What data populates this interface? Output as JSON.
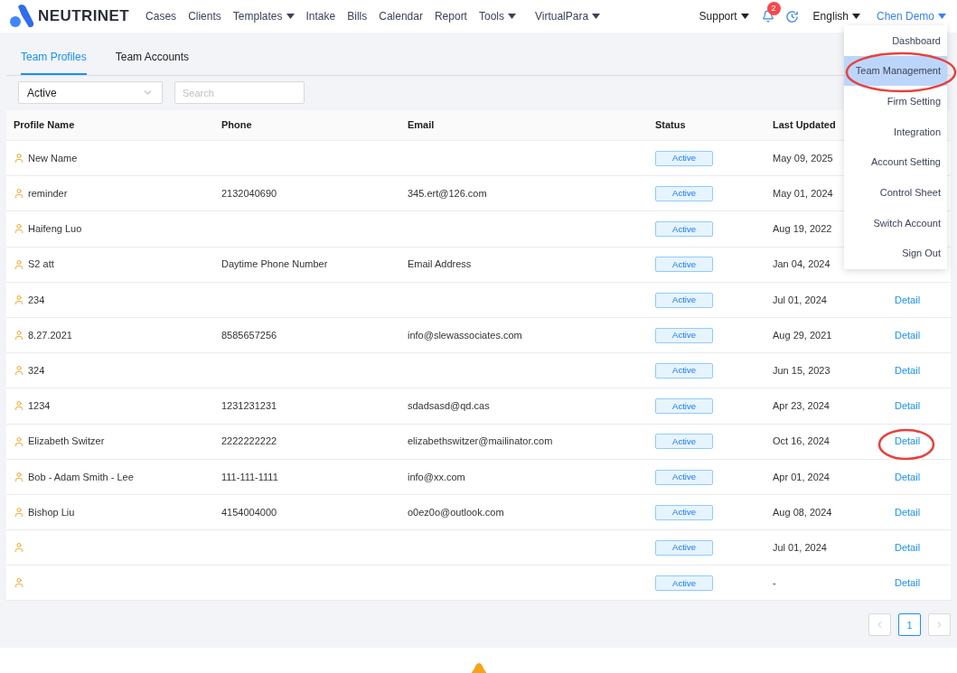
{
  "header": {
    "logo": "NEUTRINET",
    "nav": [
      {
        "label": "Cases",
        "dropdown": false
      },
      {
        "label": "Clients",
        "dropdown": false
      },
      {
        "label": "Templates",
        "dropdown": true
      },
      {
        "label": "Intake",
        "dropdown": false
      },
      {
        "label": "Bills",
        "dropdown": false
      },
      {
        "label": "Calendar",
        "dropdown": false
      },
      {
        "label": "Report",
        "dropdown": false
      },
      {
        "label": "Tools",
        "dropdown": true
      },
      {
        "label": "VirtualPara",
        "dropdown": true
      }
    ],
    "support": "Support",
    "notification_count": "2",
    "language": "English",
    "user": "Chen Demo"
  },
  "tabs": [
    {
      "label": "Team Profiles",
      "selected": true
    },
    {
      "label": "Team Accounts",
      "selected": false
    }
  ],
  "filter": {
    "value": "Active"
  },
  "search": {
    "placeholder": "Search"
  },
  "table": {
    "columns": [
      "Profile Name",
      "Phone",
      "Email",
      "Status",
      "Last Updated"
    ],
    "rows": [
      {
        "name": "New Name",
        "phone": "",
        "email": "",
        "status": "Active",
        "updated": "May 09, 2025",
        "action": ""
      },
      {
        "name": "reminder",
        "phone": "2132040690",
        "email": "345.ert@126.com",
        "status": "Active",
        "updated": "May 01, 2024",
        "action": ""
      },
      {
        "name": "Haifeng Luo",
        "phone": "",
        "email": "",
        "status": "Active",
        "updated": "Aug 19, 2022",
        "action": ""
      },
      {
        "name": "S2 att",
        "phone": "Daytime Phone Number",
        "email": "Email Address",
        "status": "Active",
        "updated": "Jan 04, 2024",
        "action": ""
      },
      {
        "name": "234",
        "phone": "",
        "email": "",
        "status": "Active",
        "updated": "Jul 01, 2024",
        "action": "Detail"
      },
      {
        "name": "8.27.2021",
        "phone": "8585657256",
        "email": "info@slewassociates.com",
        "status": "Active",
        "updated": "Aug 29, 2021",
        "action": "Detail"
      },
      {
        "name": "324",
        "phone": "",
        "email": "",
        "status": "Active",
        "updated": "Jun 15, 2023",
        "action": "Detail"
      },
      {
        "name": "1234",
        "phone": "1231231231",
        "email": "sdadsasd@qd.cas",
        "status": "Active",
        "updated": "Apr 23, 2024",
        "action": "Detail"
      },
      {
        "name": "Elizabeth Switzer",
        "phone": "2222222222",
        "email": "elizabethswitzer@mailinator.com",
        "status": "Active",
        "updated": "Oct 16, 2024",
        "action": "Detail"
      },
      {
        "name": "Bob - Adam Smith - Lee",
        "phone": "111-111-1111",
        "email": "info@xx.com",
        "status": "Active",
        "updated": "Apr 01, 2024",
        "action": "Detail"
      },
      {
        "name": "Bishop Liu",
        "phone": "4154004000",
        "email": "o0ez0o@outlook.com",
        "status": "Active",
        "updated": "Aug 08, 2024",
        "action": "Detail"
      },
      {
        "name": "",
        "phone": "",
        "email": "",
        "status": "Active",
        "updated": "Jul 01, 2024",
        "action": "Detail"
      },
      {
        "name": "",
        "phone": "",
        "email": "",
        "status": "Active",
        "updated": "-",
        "action": "Detail"
      }
    ]
  },
  "pagination": {
    "pages": [
      {
        "label": "1",
        "selected": true
      }
    ]
  },
  "user_menu": {
    "items": [
      {
        "label": "Dashboard",
        "selected": false
      },
      {
        "label": "Team Management",
        "selected": true
      },
      {
        "label": "Firm Setting",
        "selected": false
      },
      {
        "label": "Integration",
        "selected": false
      },
      {
        "label": "Account Setting",
        "selected": false
      },
      {
        "label": "Control Sheet",
        "selected": false
      },
      {
        "label": "Switch Account",
        "selected": false
      },
      {
        "label": "Sign Out",
        "selected": false
      }
    ]
  }
}
